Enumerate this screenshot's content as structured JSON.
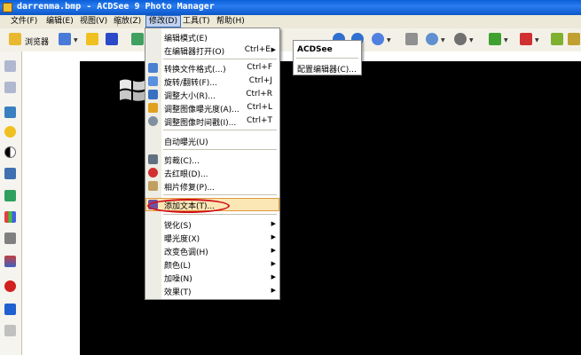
{
  "window": {
    "title": "darrenma.bmp - ACDSee 9 Photo Manager"
  },
  "menubar": [
    {
      "label": "文件(F)"
    },
    {
      "label": "编辑(E)"
    },
    {
      "label": "视图(V)"
    },
    {
      "label": "缩放(Z)"
    },
    {
      "label": "修改(D)"
    },
    {
      "label": "工具(T)"
    },
    {
      "label": "帮助(H)"
    }
  ],
  "toolbar": {
    "browser_label": "浏览器"
  },
  "modify_menu": {
    "items": [
      {
        "label": "编辑模式(E)",
        "shortcut": ""
      },
      {
        "label": "在编辑器打开(O)",
        "shortcut": "Ctrl+E"
      },
      {
        "label": "转换文件格式(...)",
        "shortcut": "Ctrl+F"
      },
      {
        "label": "旋转/翻转(F)...",
        "shortcut": "Ctrl+J"
      },
      {
        "label": "调整大小(R)...",
        "shortcut": "Ctrl+R"
      },
      {
        "label": "调整图像曝光度(A)...",
        "shortcut": "Ctrl+L"
      },
      {
        "label": "调整图像时间戳(I)...",
        "shortcut": "Ctrl+T"
      },
      {
        "label": "自动曝光(U)",
        "shortcut": ""
      },
      {
        "label": "剪裁(C)...",
        "shortcut": ""
      },
      {
        "label": "去红眼(D)...",
        "shortcut": ""
      },
      {
        "label": "相片修复(P)...",
        "shortcut": ""
      },
      {
        "label": "添加文本(T)...",
        "shortcut": ""
      },
      {
        "label": "锐化(S)",
        "shortcut": ""
      },
      {
        "label": "曝光度(X)",
        "shortcut": ""
      },
      {
        "label": "改变色调(H)",
        "shortcut": ""
      },
      {
        "label": "颜色(L)",
        "shortcut": ""
      },
      {
        "label": "加噪(N)",
        "shortcut": ""
      },
      {
        "label": "效果(T)",
        "shortcut": ""
      }
    ]
  },
  "submenu": {
    "title": "ACDSee",
    "item": "配置编辑器(C)..."
  }
}
